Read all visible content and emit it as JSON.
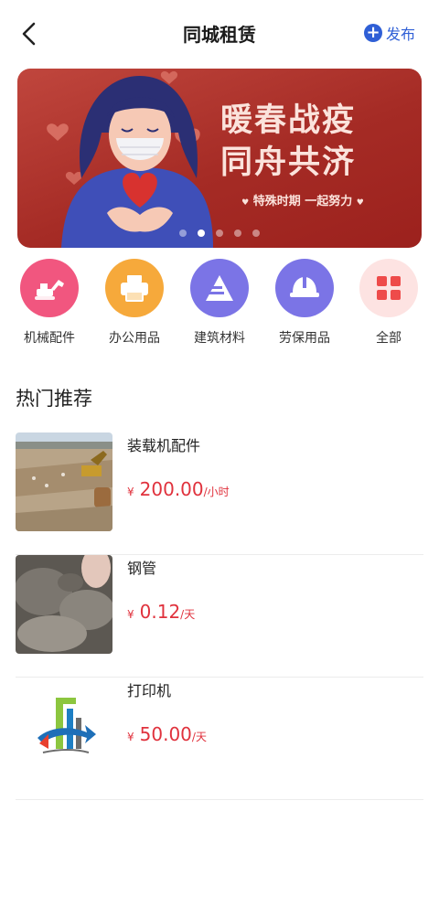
{
  "header": {
    "title": "同城租赁",
    "publish_label": "发布"
  },
  "banner": {
    "line1": "暖春战疫",
    "line2": "同舟共济",
    "subtitle": "特殊时期 一起努力",
    "slide_count": 5,
    "active_slide": 2
  },
  "categories": [
    {
      "label": "机械配件",
      "color": "#f1567f",
      "icon": "excavator-icon"
    },
    {
      "label": "办公用品",
      "color": "#f6a93b",
      "icon": "printer-icon"
    },
    {
      "label": "建筑材料",
      "color": "#7b74e6",
      "icon": "building-material-icon"
    },
    {
      "label": "劳保用品",
      "color": "#7b74e6",
      "icon": "safety-helmet-icon"
    },
    {
      "label": "全部",
      "color": "#fde3e2",
      "icon": "grid-icon"
    }
  ],
  "section": {
    "title": "热门推荐"
  },
  "items": [
    {
      "name": "装载机配件",
      "currency": "¥",
      "price": "200.00",
      "unit": "/小时"
    },
    {
      "name": "钢管",
      "currency": "¥",
      "price": "0.12",
      "unit": "/天"
    },
    {
      "name": "打印机",
      "currency": "¥",
      "price": "50.00",
      "unit": "/天"
    }
  ]
}
